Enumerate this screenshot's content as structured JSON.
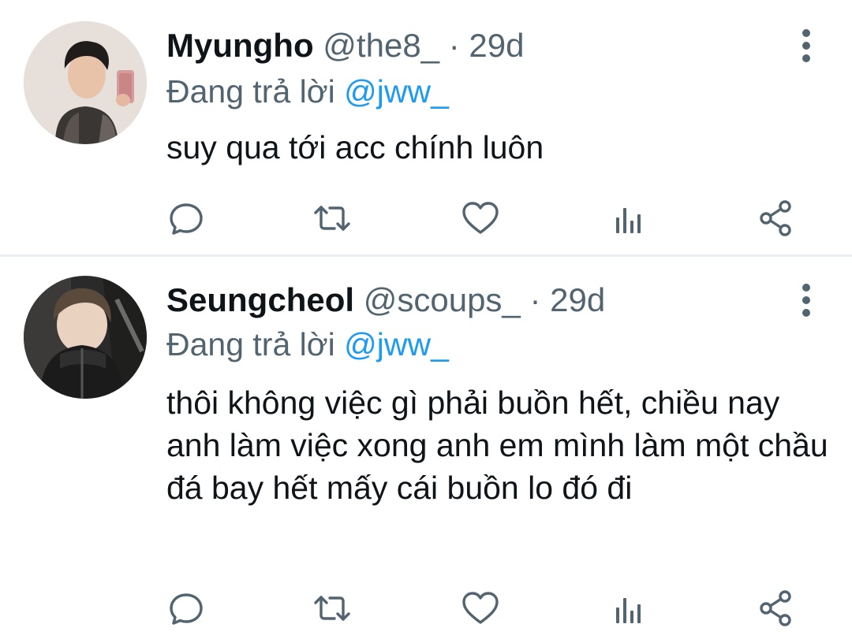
{
  "tweets": [
    {
      "name": "Myungho",
      "handle": "@the8_",
      "separator": " · ",
      "time": "29d",
      "replying_prefix": "Đang trả lời ",
      "replying_to": "@jww_",
      "text": "suy qua tới acc chính luôn"
    },
    {
      "name": "Seungcheol",
      "handle": "@scoups_",
      "separator": " · ",
      "time": "29d",
      "replying_prefix": "Đang trả lời ",
      "replying_to": "@jww_",
      "text": "thôi không việc gì phải buồn hết, chiều nay anh làm việc xong anh em mình làm một chầu đá bay hết mấy cái buồn lo đó đi"
    }
  ],
  "colors": {
    "text": "#0f1419",
    "secondary": "#536471",
    "link": "#1d9bf0",
    "divider": "#eceff1"
  },
  "icons": [
    "reply-icon",
    "retweet-icon",
    "like-icon",
    "analytics-icon",
    "share-icon",
    "more-icon"
  ]
}
